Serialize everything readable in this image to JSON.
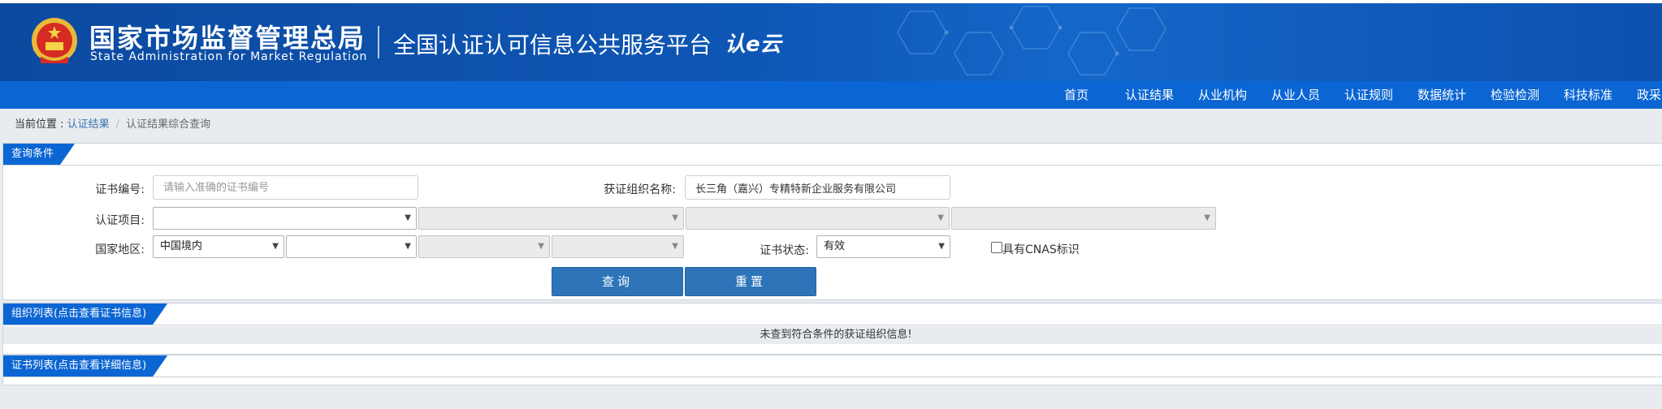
{
  "header": {
    "agency_cn": "国家市场监督管理总局",
    "agency_en": "State Administration  for  Market Regulation",
    "platform_title": "全国认证认可信息公共服务平台",
    "logo_text": "认e云"
  },
  "nav": {
    "items": [
      "首页",
      "认证结果",
      "从业机构",
      "从业人员",
      "认证规则",
      "数据统计",
      "检验检测",
      "科技标准",
      "政采"
    ]
  },
  "breadcrumb": {
    "prefix": "当前位置 : ",
    "link": "认证结果",
    "separator": "/",
    "current": "认证结果综合查询"
  },
  "query_panel": {
    "title": "查询条件",
    "cert_no_label": "证书编号:",
    "cert_no_placeholder": "请输入准确的证书编号",
    "org_name_label": "获证组织名称:",
    "org_name_value": "长三角（嘉兴）专精特新企业服务有限公司",
    "project_label": "认证项目:",
    "region_label": "国家地区:",
    "region_value": "中国境内",
    "status_label": "证书状态:",
    "status_value": "有效",
    "cnas_label": "具有CNAS标识",
    "query_button": "查询",
    "reset_button": "重置"
  },
  "org_panel": {
    "title": "组织列表(点击查看证书信息)",
    "empty_message": "未查到符合条件的获证组织信息!"
  },
  "cert_panel": {
    "title": "证书列表(点击查看详细信息)"
  },
  "colors": {
    "header_blue": "#0e56b4",
    "nav_blue": "#0b66d4",
    "button_blue": "#2d74b9"
  }
}
